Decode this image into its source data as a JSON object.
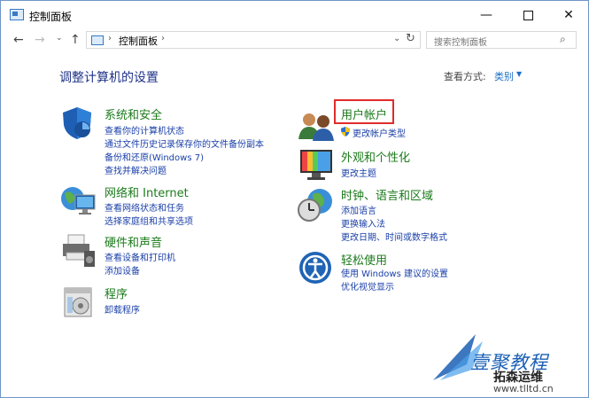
{
  "window": {
    "title": "控制面板",
    "minimize_label": "—",
    "close_label": "✕"
  },
  "nav": {
    "back": "←",
    "forward": "→",
    "recent": "⌄",
    "up": "↑",
    "path_sep": "›",
    "path": "控制面板",
    "dropdown": "⌄",
    "refresh": "↻"
  },
  "search": {
    "placeholder": "搜索控制面板",
    "icon": "⌕"
  },
  "content": {
    "heading": "调整计算机的设置",
    "view_by_label": "查看方式:",
    "view_by_value": "类别",
    "view_by_caret": "▼"
  },
  "categories": {
    "system": {
      "title": "系统和安全",
      "links": [
        "查看你的计算机状态",
        "通过文件历史记录保存你的文件备份副本",
        "备份和还原(Windows 7)",
        "查找并解决问题"
      ]
    },
    "network": {
      "title": "网络和 Internet",
      "links": [
        "查看网络状态和任务",
        "选择家庭组和共享选项"
      ]
    },
    "hardware": {
      "title": "硬件和声音",
      "links": [
        "查看设备和打印机",
        "添加设备"
      ]
    },
    "programs": {
      "title": "程序",
      "links": [
        "卸载程序"
      ]
    },
    "users": {
      "title": "用户帐户",
      "links": [
        "更改帐户类型"
      ]
    },
    "appearance": {
      "title": "外观和个性化",
      "links": [
        "更改主题"
      ]
    },
    "clock": {
      "title": "时钟、语言和区域",
      "links": [
        "添加语言",
        "更换输入法",
        "更改日期、时间或数字格式"
      ]
    },
    "ease": {
      "title": "轻松使用",
      "links": [
        "使用 Windows 建议的设置",
        "优化视觉显示"
      ]
    }
  },
  "watermark": {
    "line1": "壹聚教程",
    "line2": "拓森运维",
    "line3": "www.tlltd.cn"
  },
  "colors": {
    "heading": "#1e3287",
    "category": "#1b7a1b",
    "link": "#1a3fa8",
    "highlight": "#e22b2b"
  }
}
